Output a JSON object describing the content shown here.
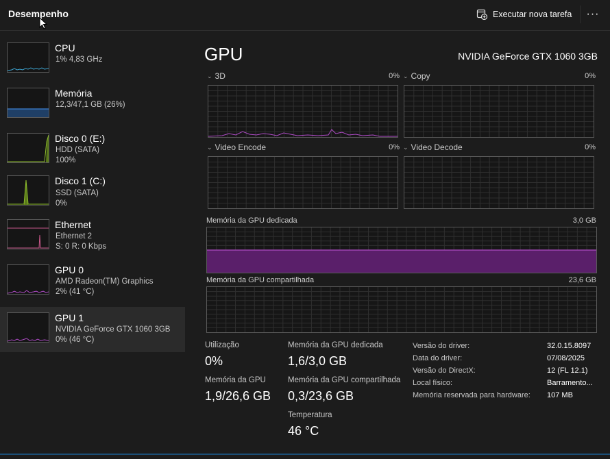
{
  "header": {
    "title": "Desempenho",
    "run_task_label": "Executar nova tarefa",
    "more_label": "···"
  },
  "sidebar": {
    "items": [
      {
        "name": "CPU",
        "line1": "1% 4,83 GHz",
        "line2": "",
        "color": "#3fa9d6"
      },
      {
        "name": "Memória",
        "line1": "12,3/47,1 GB (26%)",
        "line2": "",
        "color": "#3c7fd0"
      },
      {
        "name": "Disco 0 (E:)",
        "line1": "HDD (SATA)",
        "line2": "100%",
        "color": "#8fbf2c"
      },
      {
        "name": "Disco 1 (C:)",
        "line1": "SSD (SATA)",
        "line2": "0%",
        "color": "#8fbf2c"
      },
      {
        "name": "Ethernet",
        "line1": "Ethernet 2",
        "line2": "S: 0 R: 0 Kbps",
        "color": "#c8578a"
      },
      {
        "name": "GPU 0",
        "line1": "AMD Radeon(TM) Graphics",
        "line2": "2% (41 °C)",
        "color": "#b04cc8"
      },
      {
        "name": "GPU 1",
        "line1": "NVIDIA GeForce GTX 1060 3GB",
        "line2": "0% (46 °C)",
        "color": "#b04cc8"
      }
    ],
    "selected_index": 6
  },
  "main": {
    "title": "GPU",
    "model": "NVIDIA GeForce GTX 1060 3GB",
    "engines": [
      {
        "label": "3D",
        "pct": "0%"
      },
      {
        "label": "Copy",
        "pct": "0%"
      },
      {
        "label": "Video Encode",
        "pct": "0%"
      },
      {
        "label": "Video Decode",
        "pct": "0%"
      }
    ],
    "dedicated": {
      "label": "Memória da GPU dedicada",
      "max": "3,0 GB",
      "fill_fraction": 0.5
    },
    "shared": {
      "label": "Memória da GPU compartilhada",
      "max": "23,6 GB"
    },
    "stats": {
      "utilization_label": "Utilização",
      "utilization_value": "0%",
      "gpu_memory_label": "Memória da GPU",
      "gpu_memory_value": "1,9/26,6 GB",
      "dedicated_label": "Memória da GPU dedicada",
      "dedicated_value": "1,6/3,0 GB",
      "shared_label": "Memória da GPU compartilhada",
      "shared_value": "0,3/23,6 GB",
      "temp_label": "Temperatura",
      "temp_value": "46 °C"
    },
    "info": [
      {
        "key": "Versão do driver:",
        "value": "32.0.15.8097"
      },
      {
        "key": "Data do driver:",
        "value": "07/08/2025"
      },
      {
        "key": "Versão do DirectX:",
        "value": "12 (FL 12.1)"
      },
      {
        "key": "Local físico:",
        "value": "Barramento..."
      },
      {
        "key": "Memória reservada para hardware:",
        "value": "107 MB"
      }
    ]
  },
  "colors": {
    "gpu": "#b04cc8",
    "gpu_fill": "#5a1f6a",
    "grid": "#2f2f2f",
    "accent_blue": "#1a6fb3"
  }
}
